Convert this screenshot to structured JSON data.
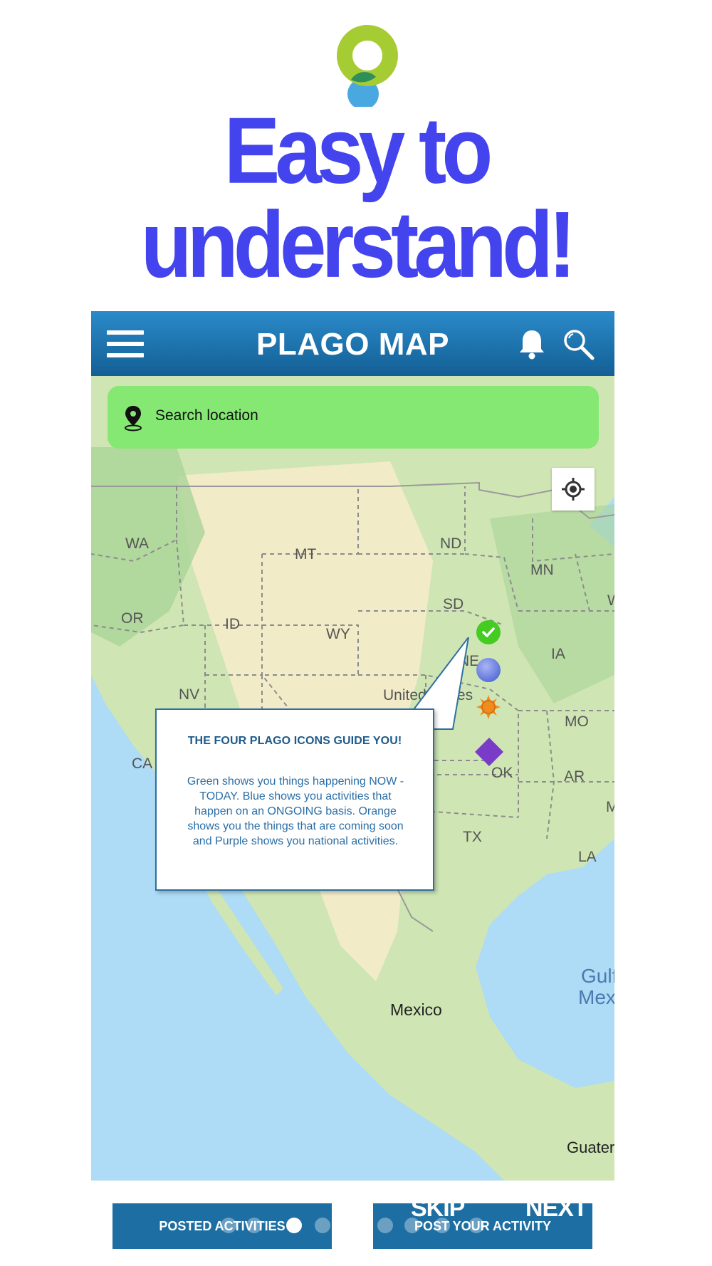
{
  "headline": "Easy to understand!",
  "app_bar": {
    "title": "PLAGO MAP",
    "menu_icon": "hamburger-menu-icon",
    "notification_icon": "bell-icon",
    "search_icon": "search-icon"
  },
  "search": {
    "placeholder": "Search location",
    "icon": "location-pin-icon"
  },
  "locate_button": {
    "icon": "crosshair-locate-icon"
  },
  "map": {
    "labels": [
      "WA",
      "MT",
      "ND",
      "MN",
      "SD",
      "OR",
      "ID",
      "WY",
      "IA",
      "NE",
      "United States",
      "NV",
      "MO",
      "CA",
      "OK",
      "AR",
      "TX",
      "LA",
      "Gulf",
      "Mex",
      "Mexico",
      "Guater",
      "W",
      "M"
    ]
  },
  "markers": [
    {
      "name": "green-now-marker",
      "color": "#44cc22",
      "icon": "check-icon"
    },
    {
      "name": "blue-ongoing-marker",
      "color": "#6a7fe0",
      "icon": "circle-icon"
    },
    {
      "name": "orange-coming-soon-marker",
      "color": "#f08c1e",
      "icon": "sun-icon"
    },
    {
      "name": "purple-national-marker",
      "color": "#7a3cc8",
      "icon": "diamond-icon"
    }
  ],
  "callout": {
    "title": "THE FOUR PLAGO ICONS GUIDE YOU!",
    "body": "Green shows you things happening NOW - TODAY. Blue shows you activities that happen on an ONGOING basis. Orange shows you the things that are coming soon and Purple shows you national activities."
  },
  "bottom": {
    "posted_activities": "POSTED ACTIVITIES",
    "post_your_activity": "POST YOUR ACTIVITY",
    "skip": "SKIP",
    "next": "NEXT",
    "page_count": 8,
    "active_page": 3
  },
  "colors": {
    "headline": "#4444ee",
    "app_bar": "#1d6ea3",
    "search_bar": "#85e873",
    "logo_green": "#a6cc33",
    "logo_blue": "#4aa8e0"
  }
}
